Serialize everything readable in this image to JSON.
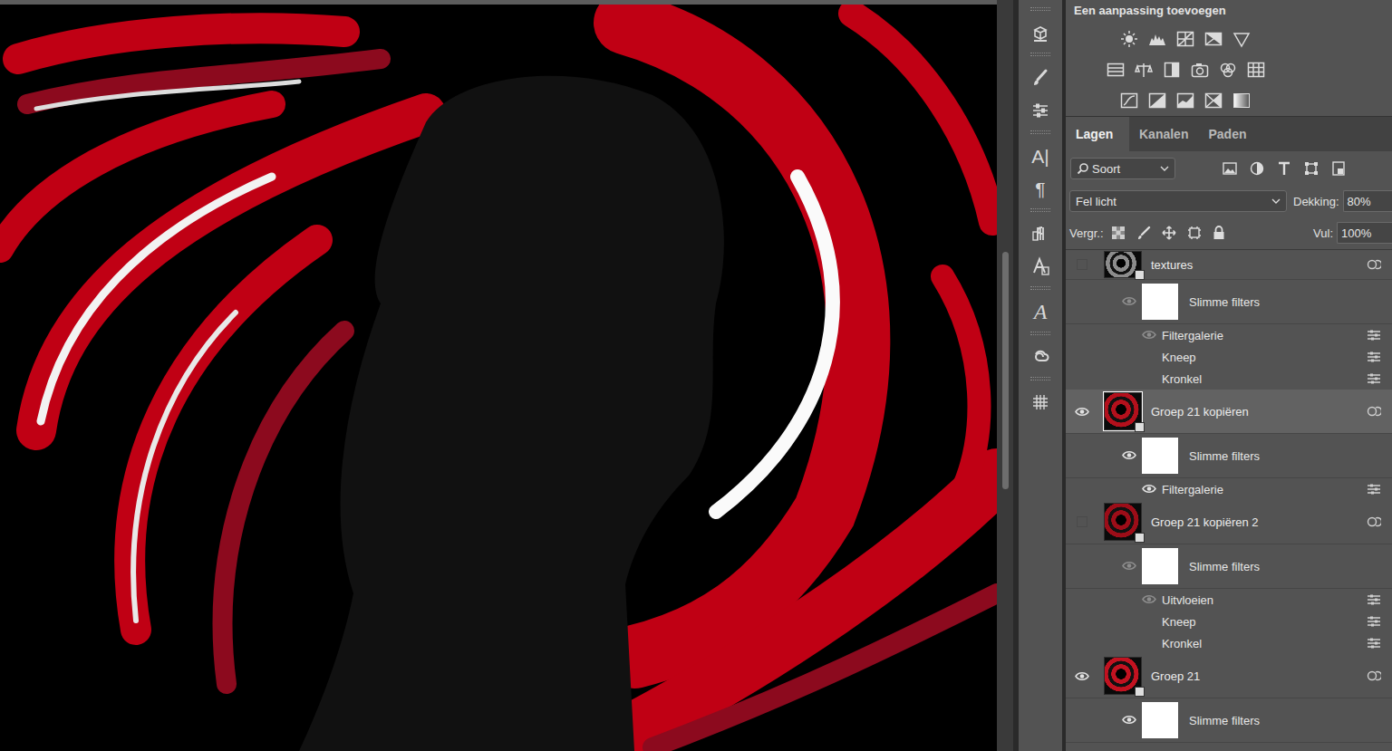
{
  "adjustments": {
    "title": "Een aanpassing toevoegen"
  },
  "toolstrip": [
    {
      "kind": "icon"
    },
    {
      "kind": "icon"
    },
    {
      "kind": "icon"
    },
    {
      "kind": "glyph",
      "label": "A|"
    },
    {
      "kind": "glyph",
      "label": "¶"
    },
    {
      "kind": "icon"
    },
    {
      "kind": "icon"
    },
    {
      "kind": "italic",
      "label": "A"
    },
    {
      "kind": "icon"
    },
    {
      "kind": "icon"
    }
  ],
  "tabs": [
    {
      "label": "Lagen",
      "selected": true
    },
    {
      "label": "Kanalen",
      "selected": false
    },
    {
      "label": "Paden",
      "selected": false
    }
  ],
  "search": {
    "label": "Soort"
  },
  "blend": {
    "mode": "Fel licht",
    "opacity_label": "Dekking:",
    "opacity": "80%"
  },
  "lock": {
    "label": "Vergr.:",
    "fill_label": "Vul:",
    "fill": "100%"
  },
  "layers": [
    {
      "name": "textures",
      "visible": false,
      "selected": false,
      "color": "#8c8c8c",
      "filters": {
        "label": "Slimme filters",
        "visible": true,
        "items": [
          {
            "name": "Filtergalerie",
            "visible": true
          },
          {
            "name": "Kneep",
            "visible": false
          },
          {
            "name": "Kronkel",
            "visible": false
          }
        ]
      }
    },
    {
      "name": "Groep 21 kopiëren",
      "visible": true,
      "selected": true,
      "color": "#b3101c",
      "filters": {
        "label": "Slimme filters",
        "visible": true,
        "items": [
          {
            "name": "Filtergalerie",
            "visible": true
          }
        ]
      }
    },
    {
      "name": "Groep 21 kopiëren 2",
      "visible": false,
      "selected": false,
      "color": "#9c0d18",
      "filters": {
        "label": "Slimme filters",
        "visible": true,
        "items": [
          {
            "name": "Uitvloeien",
            "visible": true
          },
          {
            "name": "Kneep",
            "visible": false
          },
          {
            "name": "Kronkel",
            "visible": false
          }
        ]
      }
    },
    {
      "name": "Groep 21",
      "visible": true,
      "selected": false,
      "color": "#c21220",
      "filters": {
        "label": "Slimme filters",
        "visible": true,
        "items": []
      }
    }
  ]
}
